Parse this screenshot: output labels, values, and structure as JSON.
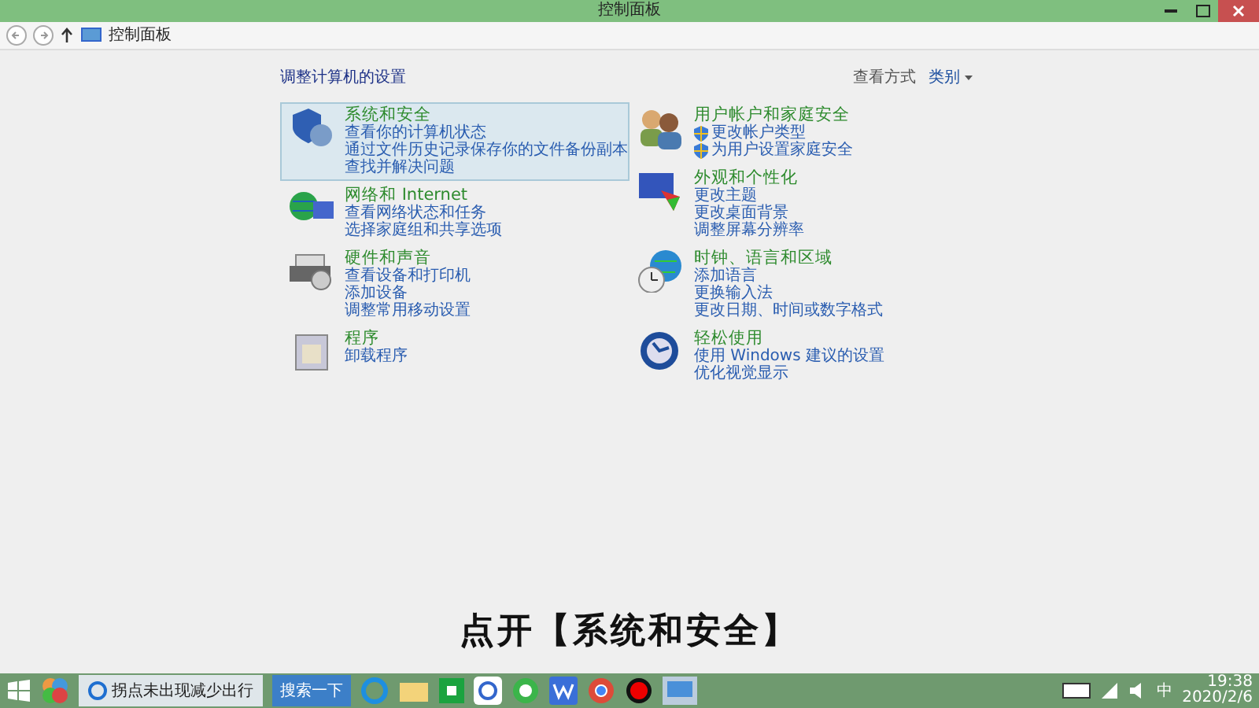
{
  "window": {
    "title": "控制面板"
  },
  "address_bar": {
    "breadcrumb": "控制面板"
  },
  "heading": "调整计算机的设置",
  "view": {
    "label": "查看方式",
    "value": "类别"
  },
  "columns": [
    [
      {
        "title": "系统和安全",
        "selected": true,
        "kind": "plain",
        "links": [
          "查看你的计算机状态",
          "通过文件历史记录保存你的文件备份副本",
          "查找并解决问题"
        ]
      },
      {
        "title": "网络和 Internet",
        "selected": false,
        "kind": "plain",
        "links": [
          "查看网络状态和任务",
          "选择家庭组和共享选项"
        ]
      },
      {
        "title": "硬件和声音",
        "selected": false,
        "kind": "plain",
        "links": [
          "查看设备和打印机",
          "添加设备",
          "调整常用移动设置"
        ]
      },
      {
        "title": "程序",
        "selected": false,
        "kind": "plain",
        "links": [
          "卸载程序"
        ]
      }
    ],
    [
      {
        "title": "用户帐户和家庭安全",
        "selected": false,
        "kind": "shield",
        "links": [
          "更改帐户类型",
          "为用户设置家庭安全"
        ]
      },
      {
        "title": "外观和个性化",
        "selected": false,
        "kind": "plain",
        "links": [
          "更改主题",
          "更改桌面背景",
          "调整屏幕分辨率"
        ]
      },
      {
        "title": "时钟、语言和区域",
        "selected": false,
        "kind": "plain",
        "links": [
          "添加语言",
          "更换输入法",
          "更改日期、时间或数字格式"
        ]
      },
      {
        "title": "轻松使用",
        "selected": false,
        "kind": "plain",
        "links": [
          "使用 Windows 建议的设置",
          "优化视觉显示"
        ]
      }
    ]
  ],
  "caption": "点开【系统和安全】",
  "taskbar": {
    "task_title": "拐点未出现减少出行",
    "search_button": "搜索一下",
    "input_indicator": "中",
    "time": "19:38",
    "date": "2020/2/6"
  }
}
